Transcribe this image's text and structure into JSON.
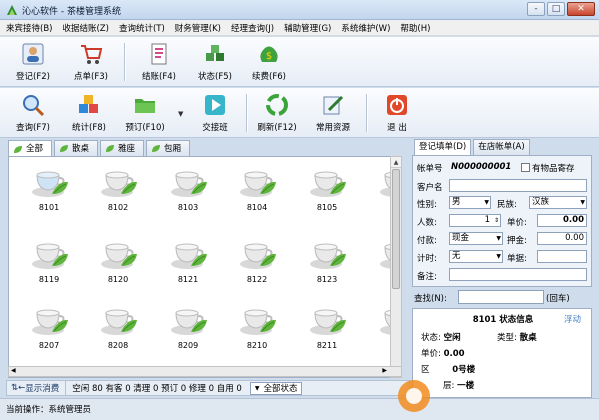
{
  "app": {
    "title": "沁心软件 - 茶楼管理系统",
    "window_controls": {
      "minimize": "-",
      "maximize": "□",
      "close": "✕"
    }
  },
  "menu": [
    "来宾接待(B)",
    "收据结账(Z)",
    "查询统计(T)",
    "财务管理(K)",
    "经理查询(J)",
    "辅助管理(G)",
    "系统维护(W)",
    "帮助(H)"
  ],
  "toolbar1": [
    {
      "label": "登记(F2)",
      "icon": "person-register-icon"
    },
    {
      "label": "点单(F3)",
      "icon": "cart-icon"
    },
    {
      "label": "结账(F4)",
      "icon": "bill-icon"
    },
    {
      "label": "状态(F5)",
      "icon": "cubes-icon"
    },
    {
      "label": "续费(F6)",
      "icon": "money-bag-icon"
    }
  ],
  "toolbar2": [
    {
      "label": "查询(F7)",
      "icon": "magnifier-icon"
    },
    {
      "label": "统计(F8)",
      "icon": "blocks-icon"
    },
    {
      "label": "预订(F10)",
      "icon": "folder-icon"
    },
    {
      "label": "交接班",
      "icon": "play-icon"
    },
    {
      "label": "刷新(F12)",
      "icon": "recycle-icon"
    },
    {
      "label": "常用资源",
      "icon": "pencil-notebook-icon"
    },
    {
      "label": "退  出",
      "icon": "power-icon"
    }
  ],
  "area_tabs": [
    "全部",
    "散桌",
    "雅座",
    "包厢"
  ],
  "tables": [
    [
      "8101",
      "8102",
      "8103",
      "8104",
      "8105",
      "81"
    ],
    [
      "8119",
      "8120",
      "8121",
      "8122",
      "8123",
      "81"
    ],
    [
      "8207",
      "8208",
      "8209",
      "8210",
      "8211",
      "82"
    ]
  ],
  "status_bar": {
    "toggle": "显示消费",
    "stats": "空闲  80  有客  0  清理  0  预订 0  修理 0  自用 0",
    "filter": "全部状态",
    "operator": "当前操作：系统管理员"
  },
  "right_tabs": [
    "登记填单(D)",
    "在店帐单(A)"
  ],
  "form": {
    "bill_no_label": "帐单号",
    "bill_no": "N000000001",
    "storage_label": "有物品寄存",
    "guest_label": "客户名",
    "gender_label": "性别:",
    "gender": "男",
    "ethnic_label": "民族:",
    "ethnic": "汉族",
    "people_label": "人数:",
    "people": "1",
    "price_label": "单价:",
    "price": "0.00",
    "pay_label": "付款:",
    "pay": "现金",
    "deposit_label": "押金:",
    "deposit": "0.00",
    "timing_label": "计时:",
    "timing": "无",
    "voucher_label": "单据:",
    "note_label": "备注:"
  },
  "search": {
    "label": "查找(N):",
    "enter": "(回车)"
  },
  "info": {
    "title": "8101 状态信息",
    "float": "浮动",
    "status_label": "状态:",
    "status": "空闲",
    "type_label": "类型:",
    "type": "散桌",
    "price_label": "单价:",
    "price": "0.00",
    "area_label": "区",
    "area": "0号楼",
    "floor_label": "层:",
    "floor": "一楼"
  },
  "colors": {
    "accent": "#3e7fc8",
    "cup_green": "#5fb53c",
    "background": "#cfdcec"
  }
}
